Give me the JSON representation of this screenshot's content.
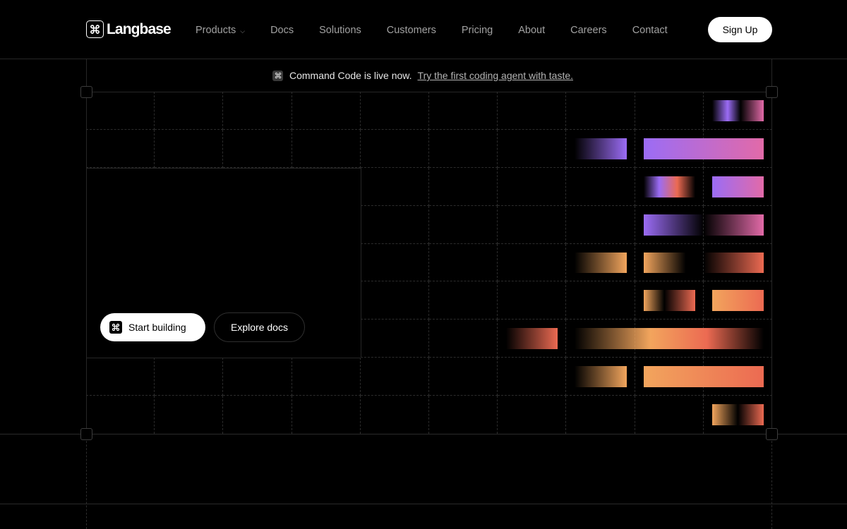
{
  "brand": {
    "name": "Langbase",
    "icon": "command-icon"
  },
  "nav": {
    "items": [
      {
        "label": "Products",
        "has_dropdown": true
      },
      {
        "label": "Docs"
      },
      {
        "label": "Solutions"
      },
      {
        "label": "Customers"
      },
      {
        "label": "Pricing"
      },
      {
        "label": "About"
      },
      {
        "label": "Careers"
      },
      {
        "label": "Contact"
      }
    ],
    "signup_label": "Sign Up"
  },
  "announcement": {
    "icon": "command-icon",
    "text": "Command Code is live now.",
    "link": "Try the first coding agent with taste."
  },
  "hero": {
    "cta_primary": "Start building",
    "cta_primary_icon": "command-icon",
    "cta_secondary": "Explore docs"
  },
  "colors": {
    "background": "#000000",
    "violet": "#9b6cf5",
    "pink": "#e26aa8",
    "coral": "#ec6a52",
    "orange": "#f2a55d"
  }
}
